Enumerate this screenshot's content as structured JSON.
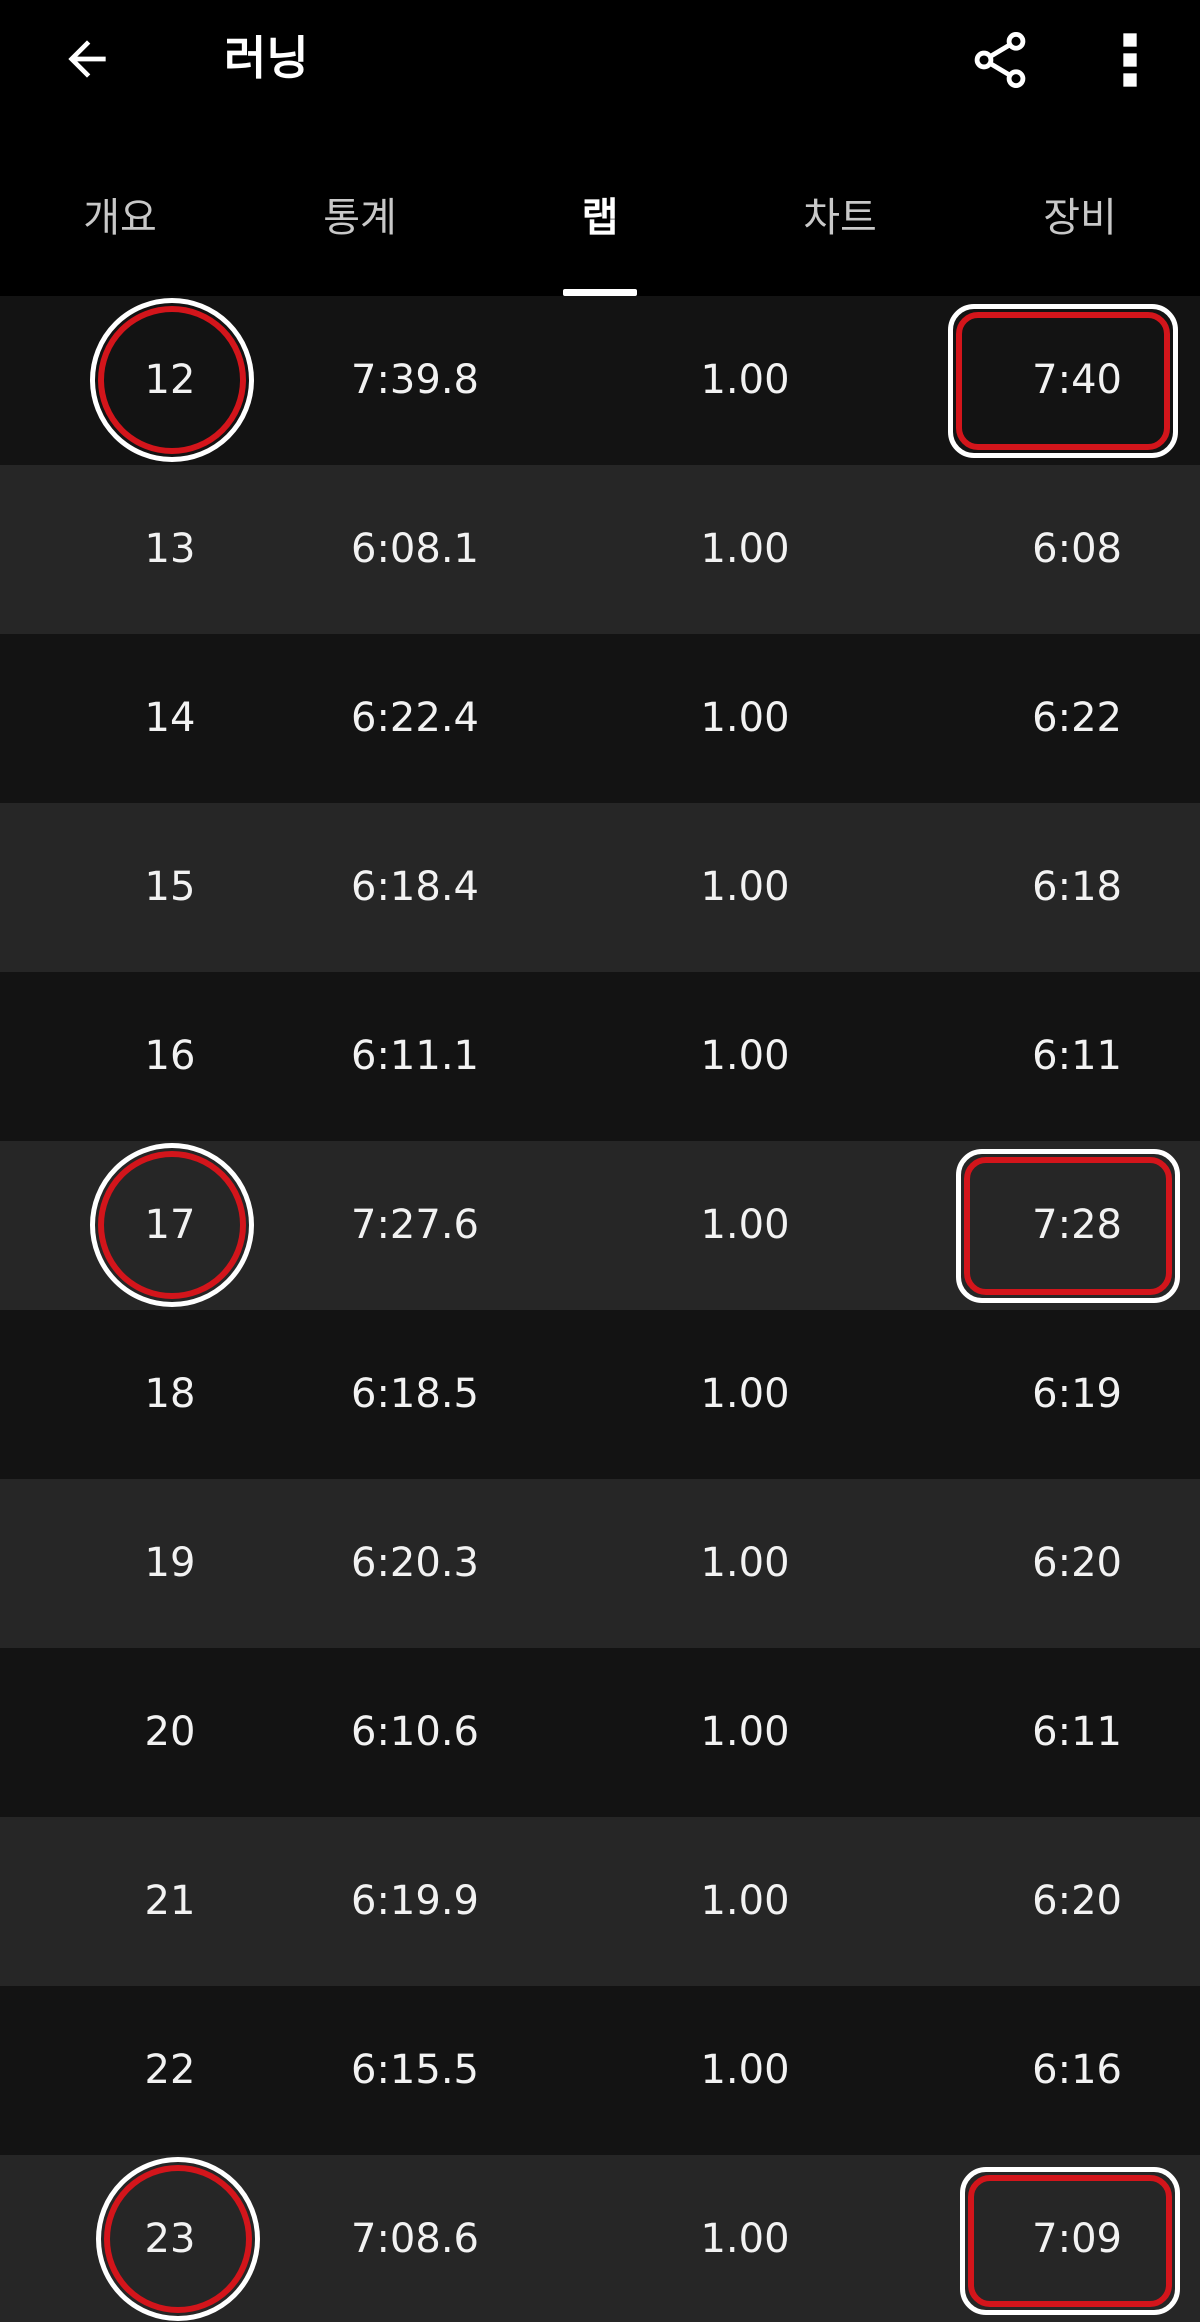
{
  "appbar": {
    "title": "러닝",
    "back_icon": "arrow-back-icon",
    "share_icon": "share-icon",
    "more_icon": "more-vert-icon"
  },
  "tabs": [
    {
      "label": "개요",
      "active": false
    },
    {
      "label": "통계",
      "active": false
    },
    {
      "label": "랩",
      "active": true
    },
    {
      "label": "차트",
      "active": false
    },
    {
      "label": "장비",
      "active": false
    }
  ],
  "laps": [
    {
      "lap": "12",
      "time": "7:39.8",
      "distance": "1.00",
      "pace": "7:40",
      "highlighted": true
    },
    {
      "lap": "13",
      "time": "6:08.1",
      "distance": "1.00",
      "pace": "6:08",
      "highlighted": false
    },
    {
      "lap": "14",
      "time": "6:22.4",
      "distance": "1.00",
      "pace": "6:22",
      "highlighted": false
    },
    {
      "lap": "15",
      "time": "6:18.4",
      "distance": "1.00",
      "pace": "6:18",
      "highlighted": false
    },
    {
      "lap": "16",
      "time": "6:11.1",
      "distance": "1.00",
      "pace": "6:11",
      "highlighted": false
    },
    {
      "lap": "17",
      "time": "7:27.6",
      "distance": "1.00",
      "pace": "7:28",
      "highlighted": true
    },
    {
      "lap": "18",
      "time": "6:18.5",
      "distance": "1.00",
      "pace": "6:19",
      "highlighted": false
    },
    {
      "lap": "19",
      "time": "6:20.3",
      "distance": "1.00",
      "pace": "6:20",
      "highlighted": false
    },
    {
      "lap": "20",
      "time": "6:10.6",
      "distance": "1.00",
      "pace": "6:11",
      "highlighted": false
    },
    {
      "lap": "21",
      "time": "6:19.9",
      "distance": "1.00",
      "pace": "6:20",
      "highlighted": false
    },
    {
      "lap": "22",
      "time": "6:15.5",
      "distance": "1.00",
      "pace": "6:16",
      "highlighted": false
    },
    {
      "lap": "23",
      "time": "7:08.6",
      "distance": "1.00",
      "pace": "7:09",
      "highlighted": true
    }
  ],
  "colors": {
    "background": "#000000",
    "row_dark": "#131313",
    "row_light": "#262626",
    "highlight_red": "#d3151b",
    "text": "#f2f2f2"
  }
}
